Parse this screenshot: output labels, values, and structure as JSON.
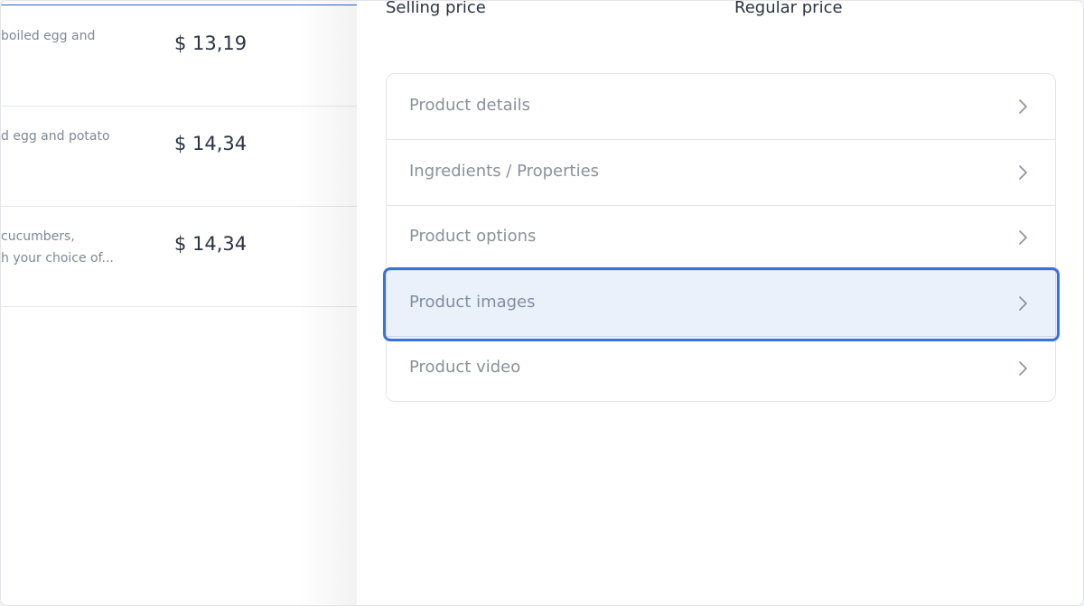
{
  "product_list": {
    "rows": [
      {
        "desc_lines": [
          "boiled egg and"
        ],
        "price": "$ 13,19"
      },
      {
        "desc_lines": [
          "d egg and potato"
        ],
        "price": "$ 14,34"
      },
      {
        "desc_lines": [
          "cucumbers,",
          "h your choice of..."
        ],
        "price": "$ 14,34"
      }
    ]
  },
  "drawer": {
    "selling_price_label": "Selling price",
    "regular_price_label": "Regular price",
    "sections": [
      {
        "label": "Product details",
        "icon": "chevron-right-icon"
      },
      {
        "label": "Ingredients / Properties",
        "icon": "chevron-right-icon"
      },
      {
        "label": "Product options",
        "icon": "chevron-right-icon"
      },
      {
        "label": "Product images",
        "icon": "chevron-right-icon"
      },
      {
        "label": "Product video",
        "icon": "chevron-right-icon"
      }
    ],
    "highlighted_section": "Product images"
  },
  "colors": {
    "accent": "#3a72db",
    "highlight_fill": "#e8f0fd",
    "text_dark": "#2b3241",
    "text_muted": "#8a919c"
  }
}
